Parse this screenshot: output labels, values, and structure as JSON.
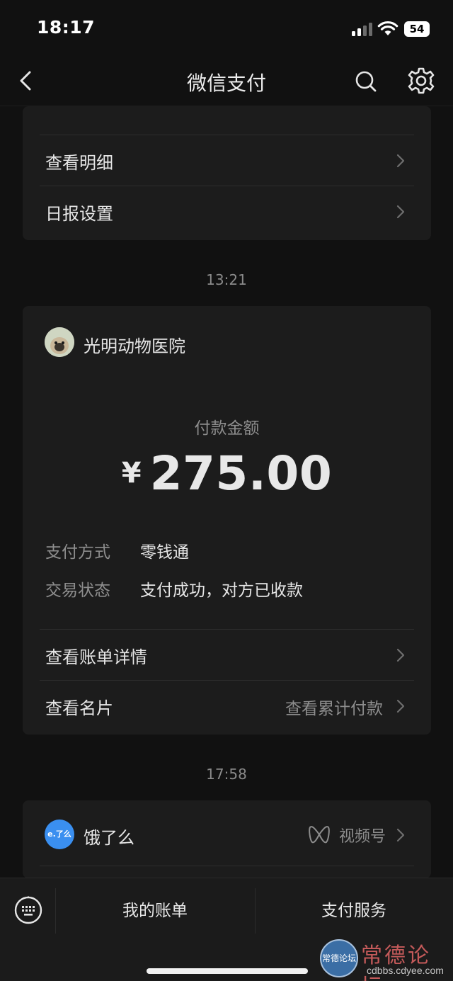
{
  "status_bar": {
    "time": "18:17",
    "battery": "54"
  },
  "nav": {
    "title": "微信支付"
  },
  "top_card": {
    "rows": [
      {
        "label": "查看明细"
      },
      {
        "label": "日报设置"
      }
    ]
  },
  "payment": {
    "time": "13:21",
    "merchant": "光明动物医院",
    "amount_label": "付款金额",
    "currency": "¥",
    "amount": "275.00",
    "method_label": "支付方式",
    "method_value": "零钱通",
    "status_label": "交易状态",
    "status_value": "支付成功，对方已收款",
    "rows": [
      {
        "label": "查看账单详情",
        "extra": ""
      },
      {
        "label": "查看名片",
        "extra": "查看累计付款"
      }
    ]
  },
  "next_card": {
    "time": "17:58",
    "logo_text": "e.了么",
    "merchant": "饿了么",
    "channels_label": "视频号"
  },
  "bottom_bar": {
    "tabs": [
      {
        "label": "我的账单"
      },
      {
        "label": "支付服务"
      }
    ]
  },
  "watermark": {
    "logo_text": "常德论坛",
    "title": "常德论坛",
    "url": "cdbbs.cdyee.com"
  },
  "colors": {
    "background": "#111111",
    "card": "#1c1c1c",
    "muted_text": "#8d8d8d",
    "accent_blue": "#3a8ff0"
  }
}
